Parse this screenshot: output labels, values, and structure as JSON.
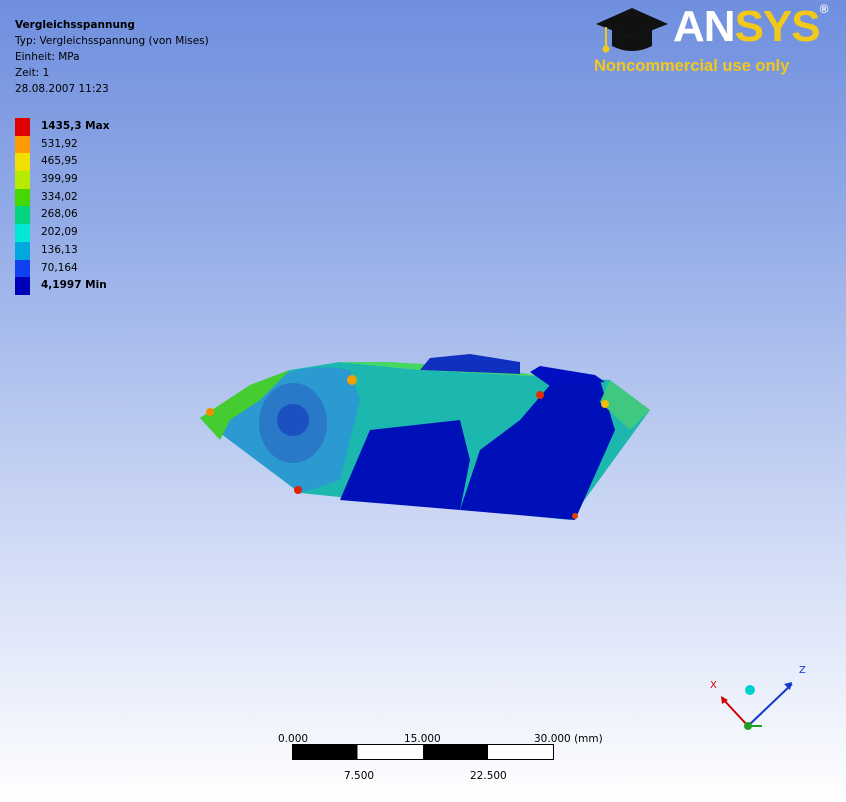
{
  "info": {
    "title": "Vergleichsspannung",
    "type": "Typ: Vergleichsspannung (von Mises)",
    "unit": "Einheit: MPa",
    "time": "Zeit: 1",
    "date": "28.08.2007 11:23"
  },
  "legend": {
    "entries": [
      {
        "label": "1435,3 Max",
        "color": "#e00000",
        "bold": true
      },
      {
        "label": "531,92",
        "color": "#ff9a00",
        "bold": false
      },
      {
        "label": "465,95",
        "color": "#f0e000",
        "bold": false
      },
      {
        "label": "399,99",
        "color": "#b8ea00",
        "bold": false
      },
      {
        "label": "334,02",
        "color": "#44d800",
        "bold": false
      },
      {
        "label": "268,06",
        "color": "#00d47c",
        "bold": false
      },
      {
        "label": "202,09",
        "color": "#00e8d4",
        "bold": false
      },
      {
        "label": "136,13",
        "color": "#00a8e0",
        "bold": false
      },
      {
        "label": "70,164",
        "color": "#1040f0",
        "bold": false
      },
      {
        "label": "4,1997 Min",
        "color": "#0000b8",
        "bold": true
      }
    ]
  },
  "logo": {
    "brand_an": "AN",
    "brand_sys": "SYS",
    "registered": "®",
    "tagline": "Noncommercial use only"
  },
  "triad": {
    "x_label": "X",
    "z_label": "Z"
  },
  "scale": {
    "top_labels": [
      "0.000",
      "15.000",
      "30.000 (mm)"
    ],
    "bottom_labels": [
      "7.500",
      "22.500"
    ]
  }
}
